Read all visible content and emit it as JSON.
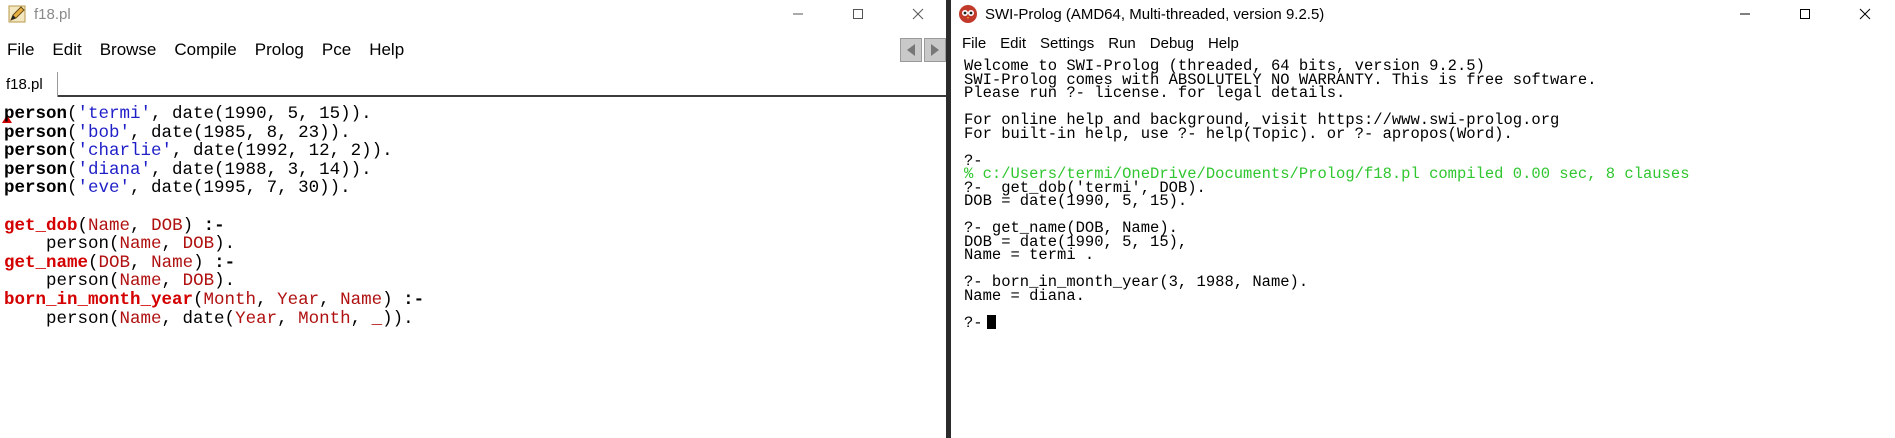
{
  "editor": {
    "title": "f18.pl",
    "menu": [
      "File",
      "Edit",
      "Browse",
      "Compile",
      "Prolog",
      "Pce",
      "Help"
    ],
    "tab_label": "f18.pl",
    "code_lines": [
      [
        {
          "t": "person",
          "c": "bold"
        },
        {
          "t": "(",
          "c": "plain"
        },
        {
          "t": "'termi'",
          "c": "str"
        },
        {
          "t": ", date(1990, 5, 15)).",
          "c": "plain"
        }
      ],
      [
        {
          "t": "person",
          "c": "bold"
        },
        {
          "t": "(",
          "c": "plain"
        },
        {
          "t": "'bob'",
          "c": "str"
        },
        {
          "t": ", date(1985, 8, 23)).",
          "c": "plain"
        }
      ],
      [
        {
          "t": "person",
          "c": "bold"
        },
        {
          "t": "(",
          "c": "plain"
        },
        {
          "t": "'charlie'",
          "c": "str"
        },
        {
          "t": ", date(1992, 12, 2)).",
          "c": "plain"
        }
      ],
      [
        {
          "t": "person",
          "c": "bold"
        },
        {
          "t": "(",
          "c": "plain"
        },
        {
          "t": "'diana'",
          "c": "str"
        },
        {
          "t": ", date(1988, 3, 14)).",
          "c": "plain"
        }
      ],
      [
        {
          "t": "person",
          "c": "bold"
        },
        {
          "t": "(",
          "c": "plain"
        },
        {
          "t": "'eve'",
          "c": "str"
        },
        {
          "t": ", date(1995, 7, 30)).",
          "c": "plain"
        }
      ],
      [],
      [
        {
          "t": "get_dob",
          "c": "head"
        },
        {
          "t": "(",
          "c": "plain"
        },
        {
          "t": "Name",
          "c": "var"
        },
        {
          "t": ", ",
          "c": "plain"
        },
        {
          "t": "DOB",
          "c": "var"
        },
        {
          "t": ") ",
          "c": "plain"
        },
        {
          "t": ":-",
          "c": "bold"
        }
      ],
      [
        {
          "t": "    person(",
          "c": "plain"
        },
        {
          "t": "Name",
          "c": "var"
        },
        {
          "t": ", ",
          "c": "plain"
        },
        {
          "t": "DOB",
          "c": "var"
        },
        {
          "t": ").",
          "c": "plain"
        }
      ],
      [
        {
          "t": "get_name",
          "c": "head"
        },
        {
          "t": "(",
          "c": "plain"
        },
        {
          "t": "DOB",
          "c": "var"
        },
        {
          "t": ", ",
          "c": "plain"
        },
        {
          "t": "Name",
          "c": "var"
        },
        {
          "t": ") ",
          "c": "plain"
        },
        {
          "t": ":-",
          "c": "bold"
        }
      ],
      [
        {
          "t": "    person(",
          "c": "plain"
        },
        {
          "t": "Name",
          "c": "var"
        },
        {
          "t": ", ",
          "c": "plain"
        },
        {
          "t": "DOB",
          "c": "var"
        },
        {
          "t": ").",
          "c": "plain"
        }
      ],
      [
        {
          "t": "born_in_month_year",
          "c": "head"
        },
        {
          "t": "(",
          "c": "plain"
        },
        {
          "t": "Month",
          "c": "var"
        },
        {
          "t": ", ",
          "c": "plain"
        },
        {
          "t": "Year",
          "c": "var"
        },
        {
          "t": ", ",
          "c": "plain"
        },
        {
          "t": "Name",
          "c": "var"
        },
        {
          "t": ") ",
          "c": "plain"
        },
        {
          "t": ":-",
          "c": "bold"
        }
      ],
      [
        {
          "t": "    person(",
          "c": "plain"
        },
        {
          "t": "Name",
          "c": "var"
        },
        {
          "t": ", date(",
          "c": "plain"
        },
        {
          "t": "Year",
          "c": "var"
        },
        {
          "t": ", ",
          "c": "plain"
        },
        {
          "t": "Month",
          "c": "var"
        },
        {
          "t": ", ",
          "c": "plain"
        },
        {
          "t": "_",
          "c": "var"
        },
        {
          "t": ")).",
          "c": "plain"
        }
      ]
    ]
  },
  "console": {
    "title": "SWI-Prolog (AMD64, Multi-threaded, version 9.2.5)",
    "menu": [
      "File",
      "Edit",
      "Settings",
      "Run",
      "Debug",
      "Help"
    ],
    "lines": [
      {
        "text": "Welcome to SWI-Prolog (threaded, 64 bits, version 9.2.5)",
        "style": "normal"
      },
      {
        "text": "SWI-Prolog comes with ABSOLUTELY NO WARRANTY. This is free software.",
        "style": "normal"
      },
      {
        "text": "Please run ?- license. for legal details.",
        "style": "normal"
      },
      {
        "text": "",
        "style": "normal"
      },
      {
        "text": "For online help and background, visit https://www.swi-prolog.org",
        "style": "normal"
      },
      {
        "text": "For built-in help, use ?- help(Topic). or ?- apropos(Word).",
        "style": "normal"
      },
      {
        "text": "",
        "style": "normal"
      },
      {
        "text": "?-",
        "style": "normal"
      },
      {
        "text": "% c:/Users/termi/OneDrive/Documents/Prolog/f18.pl compiled 0.00 sec, 8 clauses",
        "style": "green"
      },
      {
        "text": "?-  get_dob('termi', DOB).",
        "style": "normal"
      },
      {
        "text": "DOB = date(1990, 5, 15).",
        "style": "normal"
      },
      {
        "text": "",
        "style": "normal"
      },
      {
        "text": "?- get_name(DOB, Name).",
        "style": "normal"
      },
      {
        "text": "DOB = date(1990, 5, 15),",
        "style": "normal"
      },
      {
        "text": "Name = termi .",
        "style": "normal"
      },
      {
        "text": "",
        "style": "normal"
      },
      {
        "text": "?- born_in_month_year(3, 1988, Name).",
        "style": "normal"
      },
      {
        "text": "Name = diana.",
        "style": "normal"
      },
      {
        "text": "",
        "style": "normal"
      },
      {
        "text": "?-",
        "style": "prompt"
      }
    ]
  },
  "icons": {
    "editor_app": "pencil-icon",
    "console_app": "swi-prolog-owl-icon",
    "minimize": "minimize-icon",
    "maximize": "maximize-icon",
    "close": "close-icon",
    "nav_back": "arrow-left-icon",
    "nav_forward": "arrow-right-icon"
  },
  "colors": {
    "string": "#1f1fc8",
    "variable": "#b01010",
    "head": "#d40000",
    "compile_message": "#2fc62f"
  }
}
